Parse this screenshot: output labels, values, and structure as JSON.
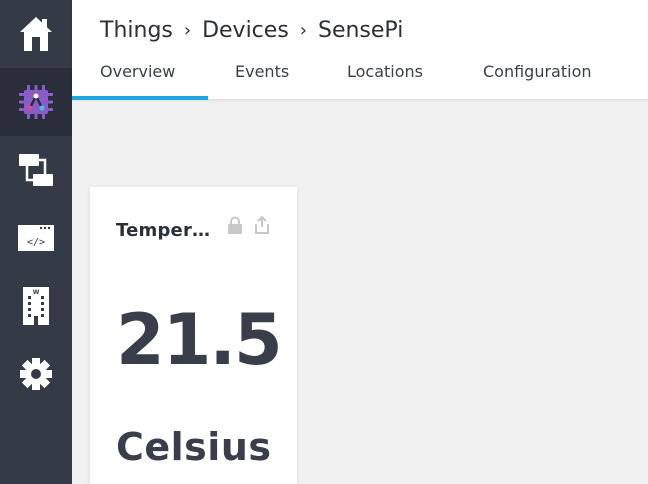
{
  "sidebar": {
    "items": [
      {
        "icon": "home-icon",
        "active": false
      },
      {
        "icon": "things-icon",
        "active": true
      },
      {
        "icon": "rules-icon",
        "active": false
      },
      {
        "icon": "logs-icon",
        "active": false
      },
      {
        "icon": "building-icon",
        "active": false
      },
      {
        "icon": "gear-icon",
        "active": false
      }
    ],
    "accent_color": "#8a5cc8"
  },
  "header": {
    "breadcrumb": [
      "Things",
      "Devices",
      "SensePi"
    ],
    "separator": "›",
    "tabs": [
      {
        "label": "Overview",
        "active": true
      },
      {
        "label": "Events",
        "active": false
      },
      {
        "label": "Locations",
        "active": false
      },
      {
        "label": "Configuration",
        "active": false
      }
    ],
    "tab_accent": "#1ea6e0"
  },
  "card": {
    "title": "Temperature",
    "value": "21.5",
    "unit": "Celsius",
    "icons": [
      "lock-icon",
      "share-icon"
    ]
  }
}
